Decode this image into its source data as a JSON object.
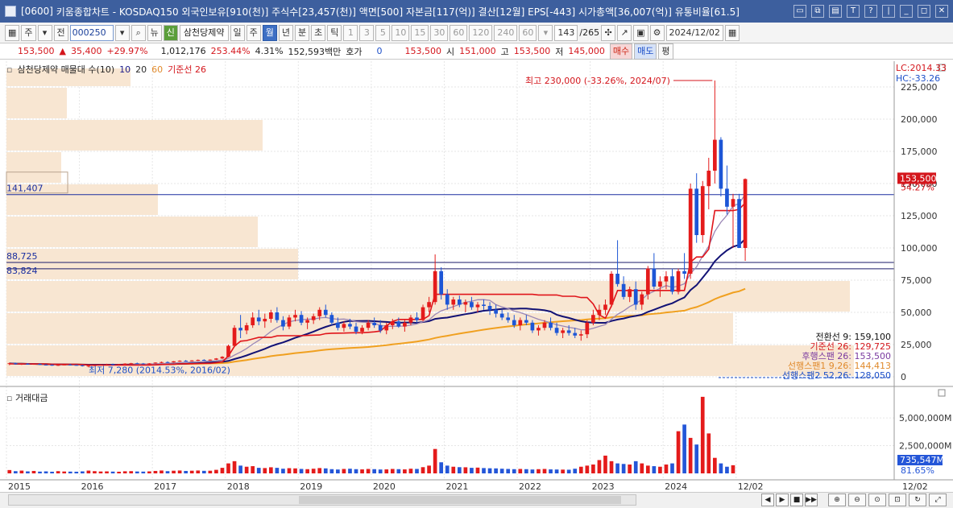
{
  "window": {
    "screen_no": "[0600]",
    "title": "키움종합차트 - KOSDAQ150 외국인보유[910(천)] 주식수[23,457(천)] 액면[500] 자본금[117(억)] 결산[12월] EPS[-443] 시가총액[36,007(억)] 유통비율[61.5]"
  },
  "toolbar": {
    "period_label": "주",
    "prev_label": "전",
    "stock_code": "000250",
    "news_label": "뉴",
    "new_label": "신",
    "stock_name": "삼천당제약",
    "intervals": [
      "일",
      "주",
      "월",
      "년",
      "분",
      "초",
      "틱"
    ],
    "selected_interval": "월",
    "minute_options": [
      "1",
      "3",
      "5",
      "10",
      "15",
      "30",
      "60",
      "120",
      "240",
      "60"
    ],
    "page_count": "143",
    "page_total": "/265",
    "date": "2024/12/02"
  },
  "quote": {
    "price": "153,500",
    "change": "35,400",
    "change_pct": "+29.97%",
    "volume": "1,012,176",
    "vol_ratio": "253.44%",
    "turnover": "4.31%",
    "amount": "152,593백만",
    "hoga_label": "호가",
    "hoga": "0",
    "ask": "153,500",
    "open_label": "시",
    "open": "151,000",
    "high_label": "고",
    "high": "153,500",
    "low_label": "저",
    "low": "145,000",
    "buy_label": "매수",
    "sell_label": "매도",
    "eval_label": "평"
  },
  "legend": {
    "title": "삼천당제약 매물대 수(10)",
    "ma1": "10",
    "ma2": "20",
    "ma3": "60",
    "base": "기준선 26"
  },
  "price_panel": {
    "lc": "LC:2014.33",
    "hc": "HC:-33.26",
    "high_note": "최고 230,000 (-33.26%, 2024/07)",
    "low_note": "최저 7,280 (2014.53%, 2016/02)",
    "current_price": "153,500",
    "current_pct": "54.27%",
    "hline1": "141,407",
    "hline2": "88,725",
    "hline3": "83,824",
    "ichimoku": [
      {
        "label": "전환선 9: 159,100",
        "color": "#111111"
      },
      {
        "label": "기준선 26: 129,725",
        "color": "#d4161c"
      },
      {
        "label": "후행스팬 26: 153,500",
        "color": "#7a3aa0"
      },
      {
        "label": "선행스팬1 9,26: 144,413",
        "color": "#e08a2c"
      },
      {
        "label": "선행스팬2 52,26: 128,050",
        "color": "#1c4fc8"
      }
    ],
    "yticks": [
      "225,000",
      "200,000",
      "175,000",
      "150,000",
      "125,000",
      "100,000",
      "75,000",
      "50,000",
      "25,000",
      "0"
    ]
  },
  "volume_panel": {
    "title": "거래대금",
    "yticks": [
      "5,000,000M",
      "2,500,000M"
    ],
    "last_value": "735,547M",
    "last_pct": "81.65%"
  },
  "xaxis": [
    "2015",
    "2016",
    "2017",
    "2018",
    "2019",
    "2020",
    "2021",
    "2022",
    "2023",
    "2024",
    "12/02"
  ],
  "chart_data": {
    "type": "candlestick",
    "x_start": "2015/01",
    "interval": "month",
    "candles": [
      [
        10000,
        11000,
        9000,
        10500
      ],
      [
        10500,
        11000,
        9500,
        9800
      ],
      [
        9800,
        10300,
        9200,
        10100
      ],
      [
        10100,
        10600,
        9400,
        9600
      ],
      [
        9600,
        10300,
        9300,
        10000
      ],
      [
        10000,
        10400,
        9200,
        9400
      ],
      [
        9400,
        9900,
        8800,
        9300
      ],
      [
        9300,
        9700,
        8500,
        8800
      ],
      [
        8800,
        9500,
        8400,
        9200
      ],
      [
        9200,
        9800,
        8900,
        9500
      ],
      [
        9500,
        10000,
        9000,
        9200
      ],
      [
        9200,
        9500,
        8600,
        8900
      ],
      [
        8900,
        9300,
        8000,
        8400
      ],
      [
        8400,
        9000,
        7280,
        8600
      ],
      [
        8600,
        9200,
        8300,
        9000
      ],
      [
        9000,
        9800,
        8800,
        9500
      ],
      [
        9500,
        10100,
        9200,
        9700
      ],
      [
        9700,
        10200,
        9300,
        9400
      ],
      [
        9400,
        10000,
        9100,
        9800
      ],
      [
        9800,
        10500,
        9500,
        10200
      ],
      [
        10200,
        10800,
        9900,
        10500
      ],
      [
        10500,
        11000,
        10000,
        10300
      ],
      [
        10300,
        10700,
        9800,
        10000
      ],
      [
        10000,
        10600,
        9700,
        10400
      ],
      [
        10400,
        11200,
        10200,
        11000
      ],
      [
        11000,
        11800,
        10600,
        11400
      ],
      [
        11400,
        12000,
        10900,
        11200
      ],
      [
        11200,
        12200,
        11000,
        12000
      ],
      [
        12000,
        12800,
        11600,
        12400
      ],
      [
        12400,
        13000,
        11800,
        12100
      ],
      [
        12100,
        12900,
        11900,
        12700
      ],
      [
        12700,
        13400,
        12300,
        13100
      ],
      [
        13100,
        13600,
        12500,
        12800
      ],
      [
        12800,
        13500,
        12400,
        13300
      ],
      [
        13300,
        14500,
        13000,
        14200
      ],
      [
        14200,
        16000,
        13800,
        15500
      ],
      [
        15500,
        25000,
        15000,
        24000
      ],
      [
        24000,
        40000,
        23000,
        38000
      ],
      [
        38000,
        48000,
        30000,
        36000
      ],
      [
        36000,
        42000,
        33000,
        40000
      ],
      [
        40000,
        50000,
        38000,
        46000
      ],
      [
        46000,
        52000,
        40000,
        43000
      ],
      [
        43000,
        49000,
        38000,
        45000
      ],
      [
        45000,
        52000,
        42000,
        50000
      ],
      [
        50000,
        54000,
        42000,
        44000
      ],
      [
        44000,
        47000,
        36000,
        39000
      ],
      [
        39000,
        48000,
        37000,
        46000
      ],
      [
        46000,
        52000,
        43000,
        48000
      ],
      [
        48000,
        51000,
        40000,
        42000
      ],
      [
        42000,
        46000,
        37000,
        44000
      ],
      [
        44000,
        49000,
        41000,
        47000
      ],
      [
        47000,
        54000,
        44000,
        52000
      ],
      [
        52000,
        56000,
        46000,
        48000
      ],
      [
        48000,
        50000,
        40000,
        42000
      ],
      [
        42000,
        46000,
        36000,
        38000
      ],
      [
        38000,
        43000,
        35000,
        41000
      ],
      [
        41000,
        45000,
        37000,
        39000
      ],
      [
        39000,
        42000,
        33000,
        35000
      ],
      [
        35000,
        40000,
        33000,
        38000
      ],
      [
        38000,
        44000,
        36000,
        42000
      ],
      [
        42000,
        46000,
        38000,
        40000
      ],
      [
        40000,
        44000,
        34000,
        36000
      ],
      [
        36000,
        42000,
        33000,
        40000
      ],
      [
        40000,
        45000,
        37000,
        43000
      ],
      [
        43000,
        46000,
        38000,
        39000
      ],
      [
        39000,
        44000,
        35000,
        42000
      ],
      [
        42000,
        48000,
        40000,
        46000
      ],
      [
        46000,
        50000,
        42000,
        44000
      ],
      [
        44000,
        56000,
        43000,
        54000
      ],
      [
        54000,
        62000,
        50000,
        58000
      ],
      [
        58000,
        95000,
        56000,
        82000
      ],
      [
        82000,
        85000,
        60000,
        64000
      ],
      [
        64000,
        68000,
        52000,
        56000
      ],
      [
        56000,
        62000,
        52000,
        60000
      ],
      [
        60000,
        63000,
        54000,
        56000
      ],
      [
        56000,
        60000,
        50000,
        58000
      ],
      [
        58000,
        62000,
        52000,
        54000
      ],
      [
        54000,
        58000,
        50000,
        56000
      ],
      [
        56000,
        60000,
        52000,
        55000
      ],
      [
        55000,
        58000,
        48000,
        52000
      ],
      [
        52000,
        56000,
        46000,
        49000
      ],
      [
        49000,
        52000,
        44000,
        46000
      ],
      [
        46000,
        50000,
        42000,
        44000
      ],
      [
        44000,
        48000,
        38000,
        40000
      ],
      [
        40000,
        46000,
        36000,
        44000
      ],
      [
        44000,
        48000,
        40000,
        42000
      ],
      [
        42000,
        44000,
        34000,
        36000
      ],
      [
        36000,
        40000,
        32000,
        38000
      ],
      [
        38000,
        44000,
        36000,
        42000
      ],
      [
        42000,
        46000,
        36000,
        38000
      ],
      [
        38000,
        42000,
        32000,
        34000
      ],
      [
        34000,
        38000,
        30000,
        36000
      ],
      [
        36000,
        40000,
        32000,
        34000
      ],
      [
        34000,
        38000,
        30000,
        32000
      ],
      [
        32000,
        36000,
        28000,
        33000
      ],
      [
        33000,
        44000,
        30000,
        42000
      ],
      [
        42000,
        52000,
        40000,
        48000
      ],
      [
        48000,
        56000,
        44000,
        52000
      ],
      [
        52000,
        60000,
        48000,
        56000
      ],
      [
        56000,
        82000,
        54000,
        80000
      ],
      [
        80000,
        106000,
        70000,
        72000
      ],
      [
        72000,
        78000,
        60000,
        62000
      ],
      [
        62000,
        70000,
        58000,
        68000
      ],
      [
        68000,
        74000,
        52000,
        56000
      ],
      [
        56000,
        66000,
        52000,
        64000
      ],
      [
        64000,
        86000,
        60000,
        84000
      ],
      [
        84000,
        96000,
        68000,
        70000
      ],
      [
        70000,
        78000,
        62000,
        74000
      ],
      [
        74000,
        82000,
        68000,
        78000
      ],
      [
        78000,
        84000,
        64000,
        66000
      ],
      [
        66000,
        84000,
        64000,
        82000
      ],
      [
        82000,
        96000,
        76000,
        80000
      ],
      [
        80000,
        150000,
        76000,
        146000
      ],
      [
        146000,
        158000,
        104000,
        110000
      ],
      [
        110000,
        152000,
        104000,
        148000
      ],
      [
        148000,
        170000,
        130000,
        160000
      ],
      [
        160000,
        230000,
        150000,
        184000
      ],
      [
        184000,
        186000,
        140000,
        146000
      ],
      [
        146000,
        164000,
        126000,
        132000
      ],
      [
        132000,
        142000,
        100000,
        138000
      ],
      [
        138000,
        142000,
        104000,
        100000
      ],
      [
        100000,
        154000,
        90000,
        153500
      ]
    ],
    "volume_million": [
      300000,
      200000,
      250000,
      180000,
      220000,
      160000,
      180000,
      150000,
      200000,
      170000,
      160000,
      150000,
      180000,
      250000,
      200000,
      170000,
      180000,
      160000,
      150000,
      190000,
      200000,
      170000,
      160000,
      180000,
      220000,
      260000,
      200000,
      240000,
      260000,
      220000,
      240000,
      260000,
      230000,
      240000,
      320000,
      500000,
      900000,
      1100000,
      700000,
      600000,
      650000,
      500000,
      480000,
      550000,
      500000,
      420000,
      470000,
      450000,
      400000,
      380000,
      420000,
      480000,
      450000,
      380000,
      350000,
      400000,
      420000,
      380000,
      360000,
      400000,
      380000,
      350000,
      360000,
      400000,
      380000,
      360000,
      420000,
      400000,
      560000,
      700000,
      2200000,
      1000000,
      700000,
      600000,
      560000,
      550000,
      500000,
      520000,
      480000,
      460000,
      450000,
      420000,
      400000,
      380000,
      400000,
      380000,
      350000,
      380000,
      400000,
      360000,
      350000,
      340000,
      330000,
      420000,
      600000,
      700000,
      800000,
      1200000,
      1600000,
      1100000,
      900000,
      850000,
      800000,
      1100000,
      900000,
      700000,
      650000,
      600000,
      800000,
      900000,
      3800000,
      4400000,
      3200000,
      2600000,
      6900000,
      3600000,
      1400000,
      900000,
      600000,
      735547
    ]
  }
}
